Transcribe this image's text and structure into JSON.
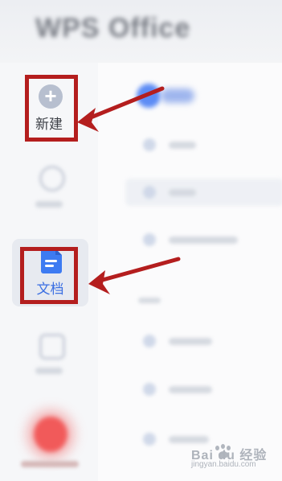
{
  "header": {
    "app_title": "WPS Office"
  },
  "left_rail": {
    "new": {
      "label": "新建",
      "icon": "plus-circle-icon"
    },
    "docs": {
      "label": "文档",
      "icon": "document-icon",
      "selected": true
    },
    "record": {
      "icon": "record-icon"
    }
  },
  "annotations": {
    "highlight_color": "#b41e1e",
    "arrow_color": "#b41e1e"
  },
  "watermark": {
    "brand": "Bai du 经验",
    "sub": "jingyan.baidu.com"
  }
}
